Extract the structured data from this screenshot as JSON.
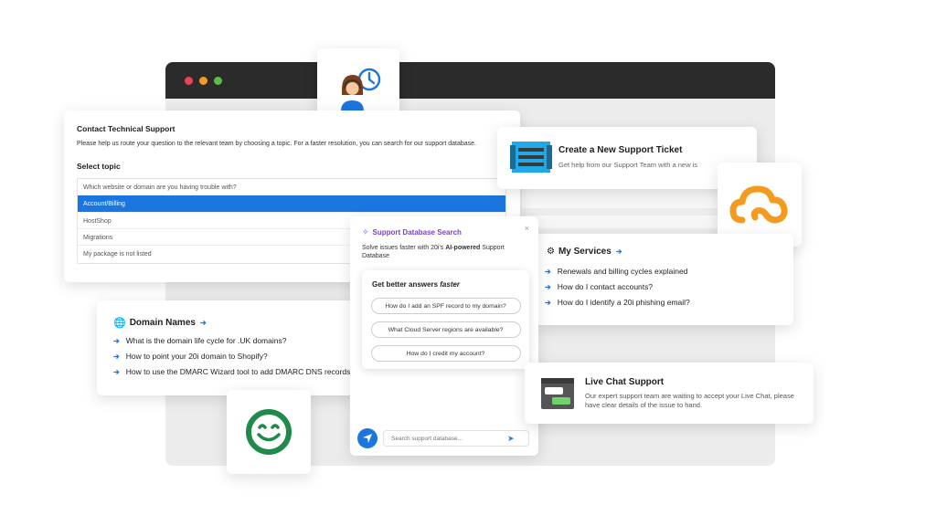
{
  "colors": {
    "accent": "#1b76e0",
    "purple": "#7b3fd1",
    "green": "#1f8a4a",
    "orange": "#f39a1f"
  },
  "contact": {
    "title": "Contact Technical Support",
    "description": "Please help us route your question to the relevant team by choosing a topic. For a faster resolution, you can search for our support database.",
    "select_label": "Select topic",
    "topics": [
      "Which website or domain are you having trouble with?",
      "Account/Billing",
      "HostShop",
      "Migrations",
      "My package is not listed"
    ],
    "selected_topic": "Account/Billing"
  },
  "ticket": {
    "title": "Create a New Support Ticket",
    "subtitle": "Get help from our Support Team with a new is"
  },
  "services": {
    "title": "My Services",
    "links": [
      "Renewals and billing cycles explained",
      "How do I contact accounts?",
      "How do I identify a 20i phishing email?"
    ]
  },
  "domains": {
    "title": "Domain Names",
    "links": [
      "What is the domain life cycle for .UK domains?",
      "How to point your 20i domain to Shopify?",
      "How to use the DMARC Wizard tool to add DMARC DNS records"
    ]
  },
  "search_widget": {
    "title": "Support Database Search",
    "desc_pre": "Solve issues faster with 20i's ",
    "desc_bold": "AI-powered",
    "desc_post": " Support Database",
    "box_title_pre": "Get better answers ",
    "box_title_em": "faster",
    "questions": [
      "How do I add an SPF record to my domain?",
      "What Cloud Server regions are available?",
      "How do I credit my account?"
    ],
    "placeholder": "Search support database..."
  },
  "chat": {
    "title": "Live Chat Support",
    "description": "Our expert support team are waiting to accept your Live Chat, please have clear details of the issue to hand."
  },
  "icons": {
    "agent": "support-agent-clock-icon",
    "server": "server-rack-icon",
    "cloud": "cloud-logo-icon",
    "smile": "smiley-logo-icon",
    "globe": "globe-icon",
    "gears": "gears-icon",
    "chat": "chat-window-icon",
    "send": "send-icon",
    "close": "close-icon"
  }
}
